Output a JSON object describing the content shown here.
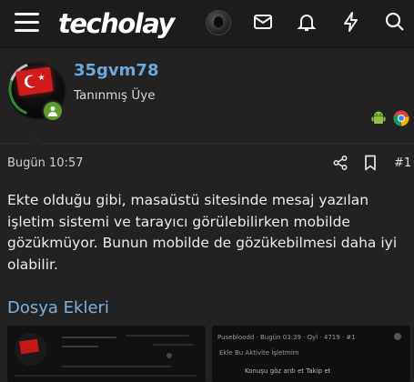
{
  "header": {
    "logo": "techolay",
    "icons": [
      "menu-icon",
      "avatar",
      "envelope-icon",
      "bell-icon",
      "bolt-icon",
      "search-icon"
    ]
  },
  "post": {
    "username": "35gvm78",
    "user_title": "Tanınmış Üye",
    "platform_icons": [
      "android-icon",
      "chrome-icon"
    ],
    "date": "Bugün 10:57",
    "number": "#1",
    "body": "Ekte olduğu gibi, masaüstü sitesinde mesaj yazılan işletim sistemi ve tarayıcı görülebilirken mobilde gözükmüyor. Bunun mobilde de gözükebilmesi daha iyi olabilir.",
    "attachments_title": "Dosya Ekleri",
    "thumb2_lines": [
      "Pusebloodd · Bugün 03:39 · Oyl · 4719 · #1",
      "Ekle Bu   Aktivite   İşletmim",
      "Konuşu göz ardı et    Takip et"
    ]
  },
  "colors": {
    "background": "#222222",
    "header_bg": "#1c1c1c",
    "username": "#6aa8dd",
    "section_title": "#7fb2dd",
    "online": "#5f9a2f"
  }
}
